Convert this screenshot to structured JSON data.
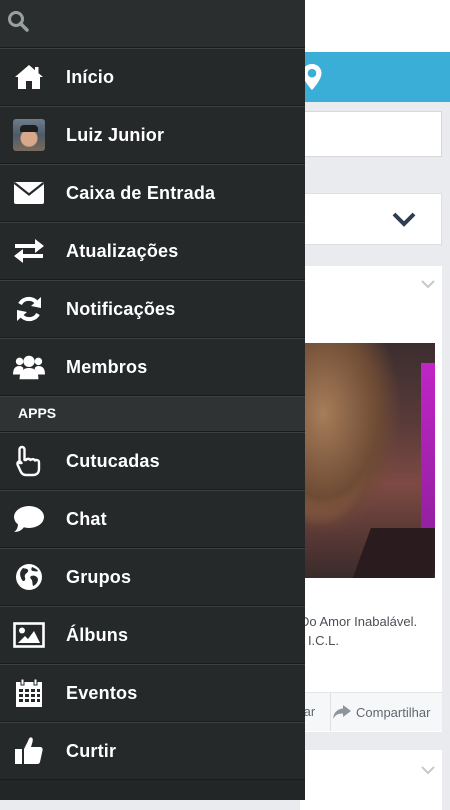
{
  "drawer": {
    "search": {
      "icon": "search-icon"
    },
    "items": [
      {
        "label": "Início",
        "icon": "home-icon"
      },
      {
        "label": "Luiz Junior",
        "icon": "avatar"
      },
      {
        "label": "Caixa de Entrada",
        "icon": "envelope-icon"
      },
      {
        "label": "Atualizações",
        "icon": "exchange-arrows-icon"
      },
      {
        "label": "Notificações",
        "icon": "refresh-icon"
      },
      {
        "label": "Membros",
        "icon": "users-icon"
      }
    ],
    "apps_section": "APPS",
    "apps": [
      {
        "label": "Cutucadas",
        "icon": "poke-hand-icon"
      },
      {
        "label": "Chat",
        "icon": "speech-bubble-icon"
      },
      {
        "label": "Grupos",
        "icon": "globe-icon"
      },
      {
        "label": "Álbuns",
        "icon": "image-icon"
      },
      {
        "label": "Eventos",
        "icon": "calendar-icon"
      },
      {
        "label": "Curtir",
        "icon": "thumbs-up-icon"
      }
    ]
  },
  "background": {
    "post_caption_line1": "Do Amor Inabalável.",
    "post_caption_line2": ") I.C.L.",
    "action_left": "tar",
    "action_share": "Compartilhar"
  },
  "colors": {
    "drawer_bg": "#262929",
    "accent_blue": "#3aaed6"
  }
}
